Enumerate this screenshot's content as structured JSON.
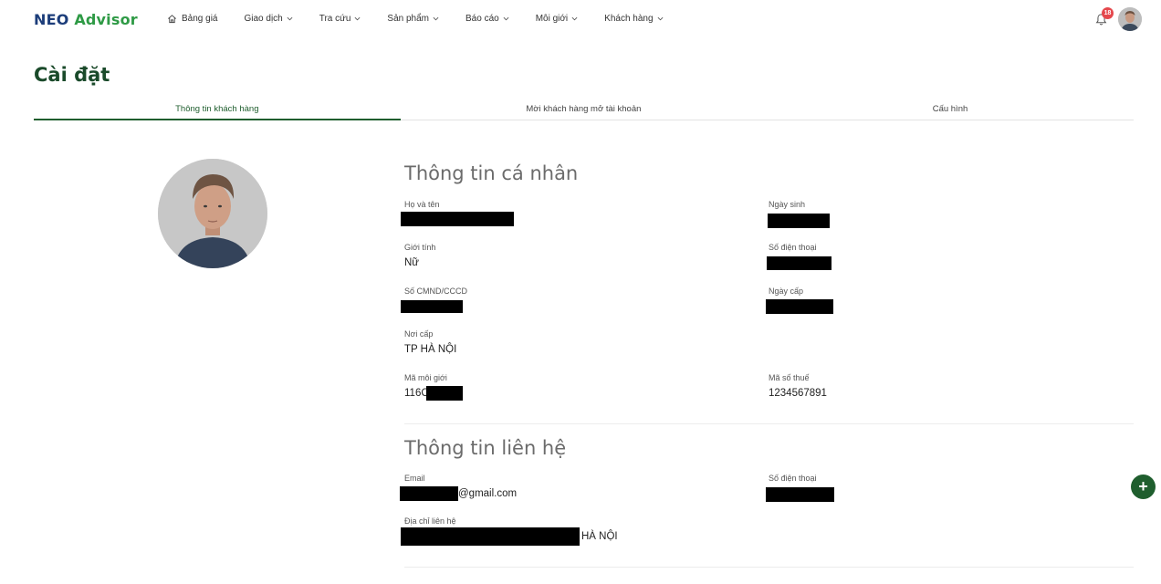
{
  "logo": {
    "part1": "NEO",
    "part2": "Advisor"
  },
  "nav": {
    "items": [
      {
        "label": "Bảng giá"
      },
      {
        "label": "Giao dịch"
      },
      {
        "label": "Tra cứu"
      },
      {
        "label": "Sản phẩm"
      },
      {
        "label": "Báo cáo"
      },
      {
        "label": "Môi giới"
      },
      {
        "label": "Khách hàng"
      }
    ],
    "notification_count": "18"
  },
  "page": {
    "title": "Cài đặt"
  },
  "tabs": [
    {
      "label": "Thông tin khách hàng",
      "active": true
    },
    {
      "label": "Mời khách hàng mở tài khoản",
      "active": false
    },
    {
      "label": "Cấu hình",
      "active": false
    }
  ],
  "personal": {
    "title": "Thông tin cá nhân",
    "full_name_label": "Họ và tên",
    "dob_label": "Ngày sinh",
    "gender_label": "Giới tính",
    "gender_value": "Nữ",
    "phone_label": "Số điện thoại",
    "id_label": "Số CMND/CCCD",
    "issue_date_label": "Ngày cấp",
    "issue_place_label": "Nơi cấp",
    "issue_place_value": "TP HÀ NỘI",
    "broker_code_label": "Mã môi giới",
    "broker_code_value": "116C",
    "tax_code_label": "Mã số thuế",
    "tax_code_value": "1234567891"
  },
  "contact": {
    "title": "Thông tin liên hệ",
    "email_label": "Email",
    "email_suffix": "@gmail.com",
    "phone_label": "Số điện thoại",
    "address_label": "Địa chỉ liên hệ",
    "address_suffix": "HÀ NỘI"
  },
  "fab": {
    "label": "+"
  },
  "colors": {
    "brand_green": "#1f5e2e",
    "brand_blue": "#1c3d7a",
    "badge_red": "#e5484d"
  }
}
